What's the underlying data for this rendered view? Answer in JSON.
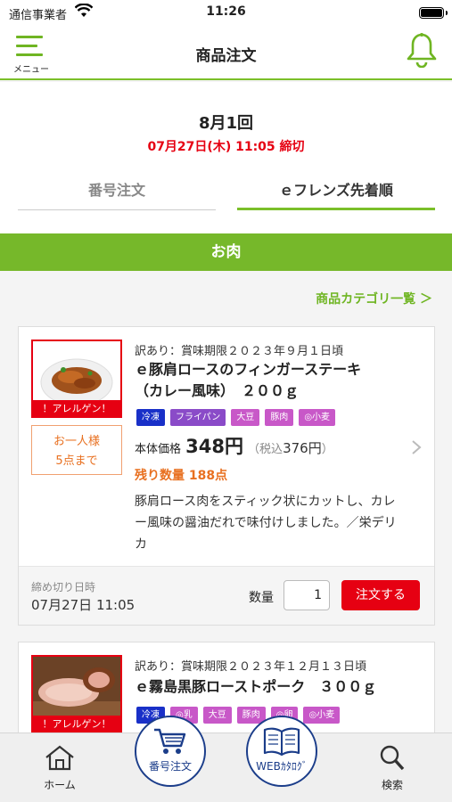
{
  "status_bar": {
    "carrier": "通信事業者",
    "time": "11:26"
  },
  "header": {
    "menu_label": "メニュー",
    "title": "商品注文"
  },
  "round": {
    "title": "8月1回",
    "deadline": "07月27日(木) 11:05 締切"
  },
  "tabs": [
    {
      "label": "番号注文",
      "active": false
    },
    {
      "label": "ｅフレンズ先着順",
      "active": true
    }
  ],
  "category": {
    "name": "お肉",
    "link": "商品カテゴリ一覧 ＞"
  },
  "colors": {
    "accent": "#76b82a",
    "alert": "#e60012",
    "orange": "#e87020",
    "navy": "#1b3d8a"
  },
  "products": [
    {
      "subtitle": "訳あり：賞味期限２０２３年９月１日頃",
      "name_line1": "ｅ豚肩ロースのフィンガーステーキ",
      "name_line2": "（カレー風味）　２００ｇ",
      "allergen_label": "！アレルゲン！",
      "limit_line1": "お一人様",
      "limit_line2": "5点まで",
      "tags": [
        {
          "label": "冷凍",
          "color": "#1930c8"
        },
        {
          "label": "フライパン",
          "color": "#8a4bc8"
        },
        {
          "label": "大豆",
          "color": "#c858c8"
        },
        {
          "label": "豚肉",
          "color": "#c858c8"
        },
        {
          "label": "◎小麦",
          "color": "#c858c8"
        }
      ],
      "price_label": "本体価格",
      "price": "348円",
      "tax_prefix": "（税込",
      "tax_value": "376円",
      "tax_suffix": "）",
      "remaining": "残り数量 188点",
      "description": "豚肩ロース肉をスティック状にカットし、カレー風味の醤油だれで味付けしました。／栄デリカ",
      "cutoff_label": "締め切り日時",
      "cutoff_value": "07月27日 11:05",
      "qty_label": "数量",
      "qty_value": "1",
      "order_label": "注文する"
    },
    {
      "subtitle": "訳あり：賞味期限２０２３年１２月１３日頃",
      "name_line1": "ｅ霧島黒豚ローストポーク　３００ｇ",
      "allergen_label": "！アレルゲン！",
      "tags": [
        {
          "label": "冷凍",
          "color": "#1930c8"
        },
        {
          "label": "◎乳",
          "color": "#c858c8"
        },
        {
          "label": "大豆",
          "color": "#c858c8"
        },
        {
          "label": "豚肉",
          "color": "#c858c8"
        },
        {
          "label": "◎卵",
          "color": "#c858c8"
        },
        {
          "label": "◎小麦",
          "color": "#c858c8"
        }
      ]
    }
  ],
  "bottom_nav": {
    "home": "ホーム",
    "number_order": "番号注文",
    "web_catalog": "WEBｶﾀﾛｸﾞ",
    "search": "検索"
  }
}
